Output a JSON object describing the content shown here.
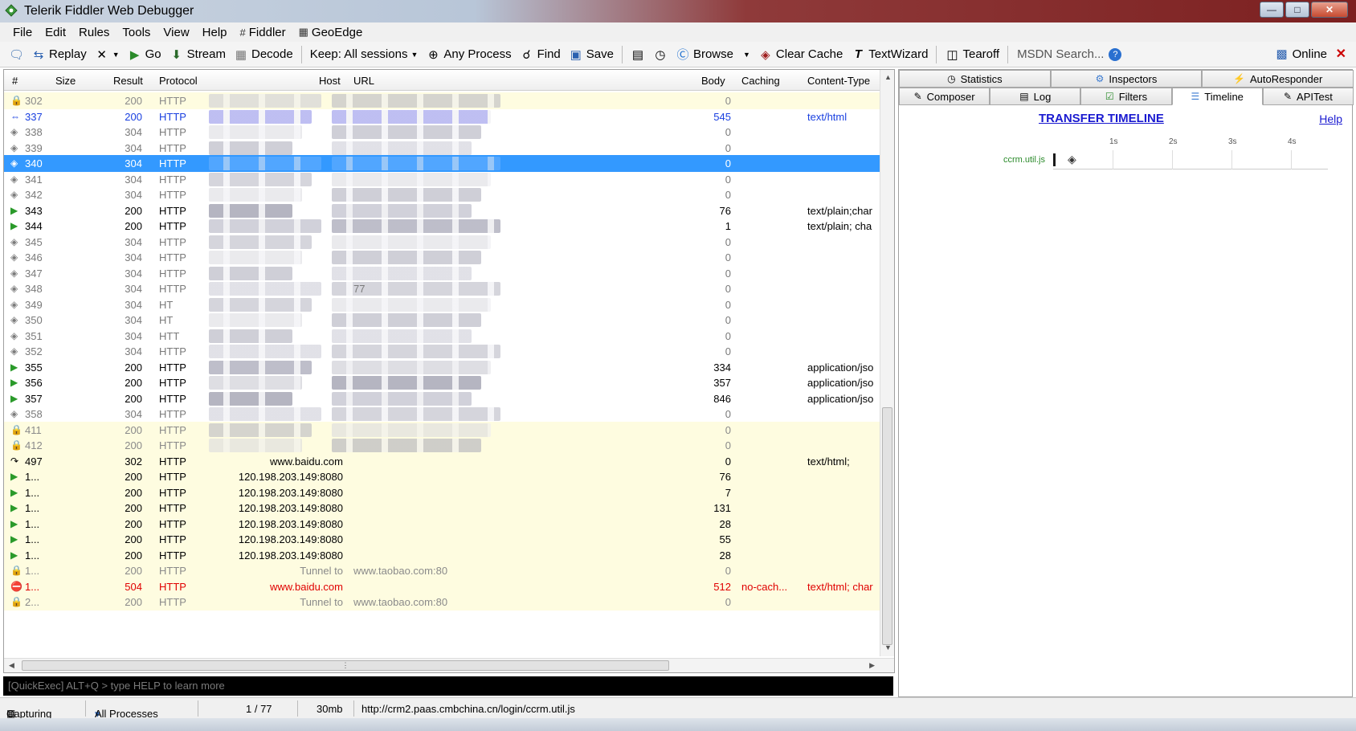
{
  "window": {
    "title": "Telerik Fiddler Web Debugger"
  },
  "menu": [
    {
      "label": "File"
    },
    {
      "label": "Edit"
    },
    {
      "label": "Rules"
    },
    {
      "label": "Tools"
    },
    {
      "label": "View"
    },
    {
      "label": "Help"
    },
    {
      "label": "Fiddler",
      "icon": "fiddler-icon"
    },
    {
      "label": "GeoEdge",
      "icon": "geoedge-icon"
    }
  ],
  "toolbar": {
    "replay": "Replay",
    "go": "Go",
    "stream": "Stream",
    "decode": "Decode",
    "keep": "Keep: All sessions",
    "process": "Any Process",
    "find": "Find",
    "save": "Save",
    "browse": "Browse",
    "clear_cache": "Clear Cache",
    "textwizard": "TextWizard",
    "tearoff": "Tearoff",
    "msdn": "MSDN Search...",
    "online": "Online"
  },
  "grid": {
    "columns": {
      "num": "#",
      "size": "Size",
      "result": "Result",
      "protocol": "Protocol",
      "host": "Host",
      "url": "URL",
      "body": "Body",
      "caching": "Caching",
      "ctype": "Content-Type"
    },
    "rows": [
      {
        "cls": "lock",
        "icon": "lock-icon",
        "num": "302",
        "result": "200",
        "proto": "HTTP",
        "host": "",
        "url": "",
        "body": "0",
        "cache": "",
        "ctype": ""
      },
      {
        "cls": "blue",
        "icon": "arrows-icon",
        "num": "337",
        "result": "200",
        "proto": "HTTP",
        "host": "",
        "url": "",
        "body": "545",
        "cache": "",
        "ctype": "text/html"
      },
      {
        "cls": "cache",
        "icon": "diamond-icon",
        "num": "338",
        "result": "304",
        "proto": "HTTP",
        "host": "",
        "url": "",
        "body": "0",
        "cache": "",
        "ctype": ""
      },
      {
        "cls": "cache",
        "icon": "diamond-icon",
        "num": "339",
        "result": "304",
        "proto": "HTTP",
        "host": "",
        "url": "",
        "body": "0",
        "cache": "",
        "ctype": ""
      },
      {
        "cls": "selected",
        "icon": "diamond-icon",
        "num": "340",
        "result": "304",
        "proto": "HTTP",
        "host": "",
        "url": "",
        "body": "0",
        "cache": "",
        "ctype": ""
      },
      {
        "cls": "cache",
        "icon": "diamond-icon",
        "num": "341",
        "result": "304",
        "proto": "HTTP",
        "host": "",
        "url": "",
        "body": "0",
        "cache": "",
        "ctype": ""
      },
      {
        "cls": "cache",
        "icon": "diamond-icon",
        "num": "342",
        "result": "304",
        "proto": "HTTP",
        "host": "",
        "url": "",
        "body": "0",
        "cache": "",
        "ctype": ""
      },
      {
        "cls": "ok",
        "icon": "document-icon",
        "num": "343",
        "result": "200",
        "proto": "HTTP",
        "host": "",
        "url": "",
        "body": "76",
        "cache": "",
        "ctype": "text/plain;char"
      },
      {
        "cls": "ok",
        "icon": "document-icon",
        "num": "344",
        "result": "200",
        "proto": "HTTP",
        "host": "",
        "url": "",
        "body": "1",
        "cache": "",
        "ctype": "text/plain; cha"
      },
      {
        "cls": "cache",
        "icon": "diamond-icon",
        "num": "345",
        "result": "304",
        "proto": "HTTP",
        "host": "",
        "url": "",
        "body": "0",
        "cache": "",
        "ctype": ""
      },
      {
        "cls": "cache",
        "icon": "diamond-icon",
        "num": "346",
        "result": "304",
        "proto": "HTTP",
        "host": "",
        "url": "",
        "body": "0",
        "cache": "",
        "ctype": ""
      },
      {
        "cls": "cache",
        "icon": "diamond-icon",
        "num": "347",
        "result": "304",
        "proto": "HTTP",
        "host": "",
        "url": "",
        "body": "0",
        "cache": "",
        "ctype": ""
      },
      {
        "cls": "cache",
        "icon": "diamond-icon",
        "num": "348",
        "result": "304",
        "proto": "HTTP",
        "host": "",
        "url": "77",
        "body": "0",
        "cache": "",
        "ctype": ""
      },
      {
        "cls": "cache",
        "icon": "diamond-icon",
        "num": "349",
        "result": "304",
        "proto": "HT",
        "host": "",
        "url": "",
        "body": "0",
        "cache": "",
        "ctype": ""
      },
      {
        "cls": "cache",
        "icon": "diamond-icon",
        "num": "350",
        "result": "304",
        "proto": "HT",
        "host": "",
        "url": "",
        "body": "0",
        "cache": "",
        "ctype": ""
      },
      {
        "cls": "cache",
        "icon": "diamond-icon",
        "num": "351",
        "result": "304",
        "proto": "HTT",
        "host": "",
        "url": "",
        "body": "0",
        "cache": "",
        "ctype": ""
      },
      {
        "cls": "cache",
        "icon": "diamond-icon",
        "num": "352",
        "result": "304",
        "proto": "HTTP",
        "host": "",
        "url": "",
        "body": "0",
        "cache": "",
        "ctype": ""
      },
      {
        "cls": "ok",
        "icon": "document-icon",
        "num": "355",
        "result": "200",
        "proto": "HTTP",
        "host": "",
        "url": "",
        "body": "334",
        "cache": "",
        "ctype": "application/jso"
      },
      {
        "cls": "ok",
        "icon": "document-icon",
        "num": "356",
        "result": "200",
        "proto": "HTTP",
        "host": "",
        "url": "",
        "body": "357",
        "cache": "",
        "ctype": "application/jso"
      },
      {
        "cls": "ok",
        "icon": "document-icon",
        "num": "357",
        "result": "200",
        "proto": "HTTP",
        "host": "",
        "url": "",
        "body": "846",
        "cache": "",
        "ctype": "application/jso"
      },
      {
        "cls": "cache",
        "icon": "diamond-icon",
        "num": "358",
        "result": "304",
        "proto": "HTTP",
        "host": "",
        "url": "",
        "body": "0",
        "cache": "",
        "ctype": ""
      },
      {
        "cls": "lock",
        "icon": "lock-icon",
        "num": "411",
        "result": "200",
        "proto": "HTTP",
        "host": "",
        "url": "",
        "body": "0",
        "cache": "",
        "ctype": ""
      },
      {
        "cls": "lock",
        "icon": "lock-icon",
        "num": "412",
        "result": "200",
        "proto": "HTTP",
        "host": "",
        "url": "",
        "body": "0",
        "cache": "",
        "ctype": ""
      },
      {
        "cls": "redirect",
        "icon": "redirect-icon",
        "num": "497",
        "result": "302",
        "proto": "HTTP",
        "host": "www.baidu.com",
        "url": "",
        "body": "0",
        "cache": "",
        "ctype": "text/html;"
      },
      {
        "cls": "proxy",
        "icon": "document-icon",
        "num": "1...",
        "result": "200",
        "proto": "HTTP",
        "host": "120.198.203.149:8080",
        "url": "",
        "body": "76",
        "cache": "",
        "ctype": ""
      },
      {
        "cls": "proxy",
        "icon": "document-icon",
        "num": "1...",
        "result": "200",
        "proto": "HTTP",
        "host": "120.198.203.149:8080",
        "url": "",
        "body": "7",
        "cache": "",
        "ctype": ""
      },
      {
        "cls": "proxy",
        "icon": "document-icon",
        "num": "1...",
        "result": "200",
        "proto": "HTTP",
        "host": "120.198.203.149:8080",
        "url": "",
        "body": "131",
        "cache": "",
        "ctype": ""
      },
      {
        "cls": "proxy",
        "icon": "document-icon",
        "num": "1...",
        "result": "200",
        "proto": "HTTP",
        "host": "120.198.203.149:8080",
        "url": "",
        "body": "28",
        "cache": "",
        "ctype": ""
      },
      {
        "cls": "proxy",
        "icon": "document-icon",
        "num": "1...",
        "result": "200",
        "proto": "HTTP",
        "host": "120.198.203.149:8080",
        "url": "",
        "body": "55",
        "cache": "",
        "ctype": ""
      },
      {
        "cls": "proxy",
        "icon": "document-icon",
        "num": "1...",
        "result": "200",
        "proto": "HTTP",
        "host": "120.198.203.149:8080",
        "url": "",
        "body": "28",
        "cache": "",
        "ctype": ""
      },
      {
        "cls": "tunnel",
        "icon": "lock-icon",
        "num": "1...",
        "result": "200",
        "proto": "HTTP",
        "host": "Tunnel to",
        "url": "www.taobao.com:80",
        "body": "0",
        "cache": "",
        "ctype": ""
      },
      {
        "cls": "err",
        "icon": "error-icon",
        "num": "1...",
        "result": "504",
        "proto": "HTTP",
        "host": "www.baidu.com",
        "url": "",
        "body": "512",
        "cache": "no-cach...",
        "ctype": "text/html; char"
      },
      {
        "cls": "tunnel",
        "icon": "lock-icon",
        "num": "2...",
        "result": "200",
        "proto": "HTTP",
        "host": "Tunnel to",
        "url": "www.taobao.com:80",
        "body": "0",
        "cache": "",
        "ctype": ""
      }
    ]
  },
  "quickexec": {
    "placeholder": "[QuickExec] ALT+Q > type HELP to learn more"
  },
  "status": {
    "capturing": "Capturing",
    "processes": "All Processes",
    "count": "1 / 77",
    "memory": "30mb",
    "url": "http://crm2.paas.cmbchina.cn/login/ccrm.util.js"
  },
  "right": {
    "tabs_top": [
      {
        "label": "Statistics",
        "icon": "stopwatch-icon"
      },
      {
        "label": "Inspectors",
        "icon": "inspectors-icon"
      },
      {
        "label": "AutoResponder",
        "icon": "lightning-icon"
      }
    ],
    "tabs_bottom": [
      {
        "label": "Composer",
        "icon": "pencil-icon"
      },
      {
        "label": "Log",
        "icon": "log-icon"
      },
      {
        "label": "Filters",
        "icon": "checkbox-icon"
      },
      {
        "label": "Timeline",
        "icon": "timeline-icon",
        "active": true
      },
      {
        "label": "APITest",
        "icon": "apitest-icon"
      }
    ],
    "timeline": {
      "title": "TRANSFER TIMELINE",
      "help": "Help",
      "ticks": [
        "1s",
        "2s",
        "3s",
        "4s"
      ],
      "file": "ccrm.util.js"
    }
  },
  "colors": {
    "selected_row": "#3399ff",
    "error": "#e00000",
    "link": "#1a1ad0",
    "timeline_file": "#2a8a2a"
  }
}
